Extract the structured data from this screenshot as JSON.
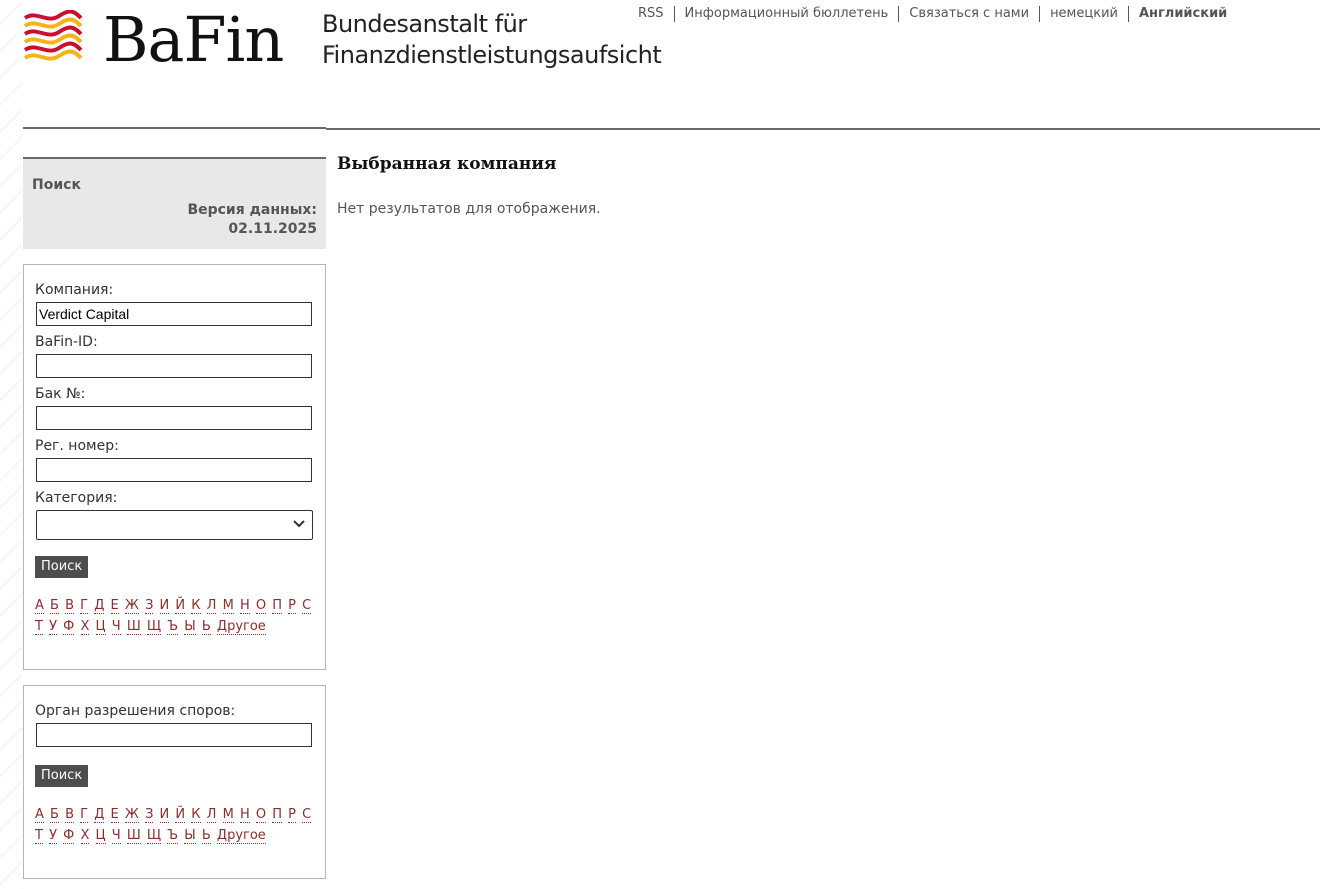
{
  "header": {
    "brand": "BaFin",
    "agency_line1": "Bundesanstalt für",
    "agency_line2": "Finanzdienstleistungsaufsicht",
    "nav": [
      "RSS",
      "Информационный бюллетень",
      "Связаться с нами",
      "немецкий",
      "Английский"
    ]
  },
  "sidebar": {
    "search_title": "Поиск",
    "version_label": "Версия данных:",
    "version_date": "02.11.2025",
    "company_form": {
      "company_label": "Компания:",
      "company_value": "Verdict Capital",
      "bafin_id_label": "BaFin-ID:",
      "bafin_id_value": "",
      "bank_no_label": "Бак №:",
      "bank_no_value": "",
      "reg_no_label": "Рег. номер:",
      "reg_no_value": "",
      "category_label": "Категория:",
      "category_value": "",
      "search_button": "Поиск",
      "alphabet": [
        "А",
        "Б",
        "В",
        "Г",
        "Д",
        "Е",
        "Ж",
        "З",
        "И",
        "Й",
        "К",
        "Л",
        "М",
        "Н",
        "О",
        "П",
        "Р",
        "С",
        "Т",
        "У",
        "Ф",
        "Х",
        "Ц",
        "Ч",
        "Ш",
        "Щ",
        "Ъ",
        "Ы",
        "Ь",
        "Другое"
      ]
    },
    "dispute_form": {
      "label": "Орган разрешения споров:",
      "value": "",
      "search_button": "Поиск",
      "alphabet": [
        "А",
        "Б",
        "В",
        "Г",
        "Д",
        "Е",
        "Ж",
        "З",
        "И",
        "Й",
        "К",
        "Л",
        "М",
        "Н",
        "О",
        "П",
        "Р",
        "С",
        "Т",
        "У",
        "Ф",
        "Х",
        "Ц",
        "Ч",
        "Ш",
        "Щ",
        "Ъ",
        "Ы",
        "Ь",
        "Другое"
      ]
    }
  },
  "main": {
    "title": "Выбранная компания",
    "no_results": "Нет результатов для отображения."
  },
  "colors": {
    "link": "#8b2e2e",
    "button_bg": "#4d4d4d",
    "panel_bg": "#e8e8e8",
    "logo_red": "#c8102e",
    "logo_gold": "#f2b418"
  },
  "icons": {
    "logo": "bafin-waves-logo-icon",
    "select_arrow": "chevron-down-icon"
  }
}
